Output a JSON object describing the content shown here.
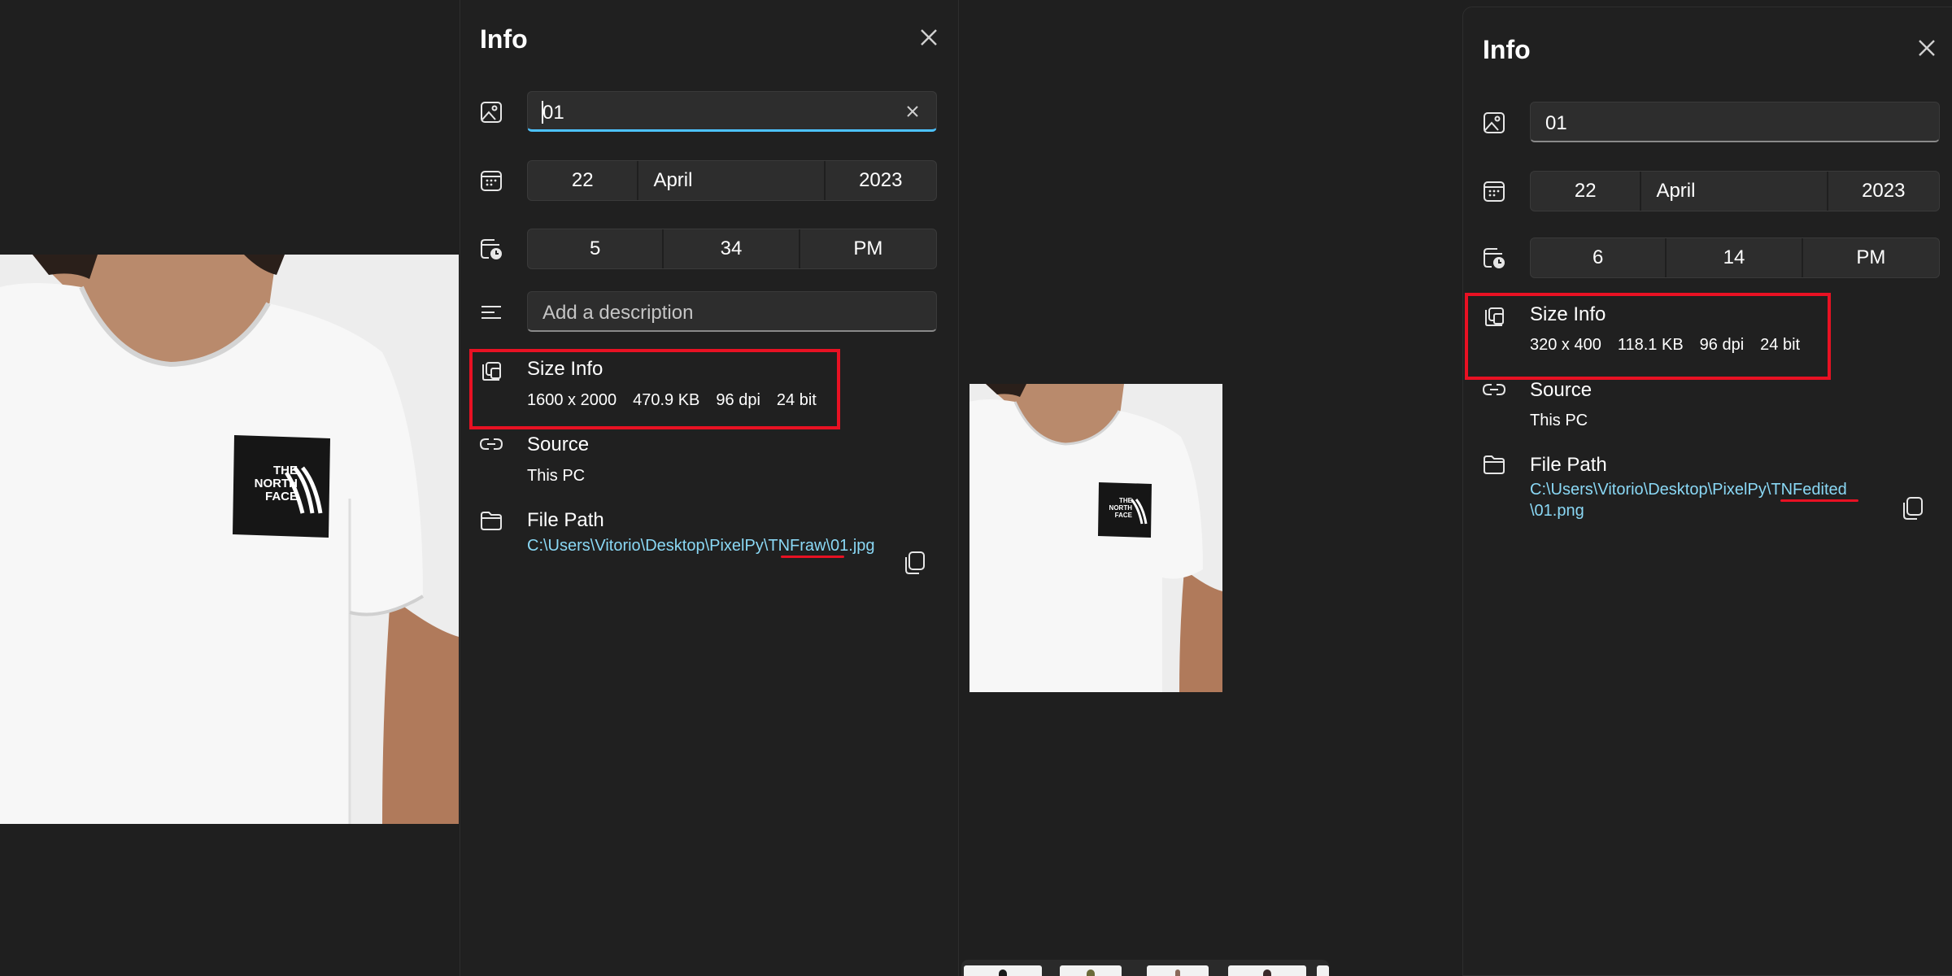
{
  "colors": {
    "background": "#1f1f1f",
    "panel": "#202020",
    "field": "#2d2d2d",
    "accent": "#4cc2ff",
    "link": "#8ad8f5",
    "highlight": "#e81123"
  },
  "photo_left": {
    "logo_lines": [
      "THE",
      "NORTH",
      "FACE"
    ]
  },
  "photo_mid": {
    "logo_lines": [
      "THE",
      "NORTH",
      "FACE"
    ]
  },
  "left_panel": {
    "title": "Info",
    "name_value": "01",
    "date": {
      "day": "22",
      "month": "April",
      "year": "2023"
    },
    "time": {
      "hour": "5",
      "minute": "34",
      "period": "PM"
    },
    "description_placeholder": "Add a description",
    "size_info": {
      "title": "Size Info",
      "dimensions": "1600 x 2000",
      "file_size": "470.9 KB",
      "dpi": "96 dpi",
      "bit_depth": "24 bit"
    },
    "source": {
      "title": "Source",
      "value": "This PC"
    },
    "file_path": {
      "title": "File Path",
      "value": "C:\\Users\\Vitorio\\Desktop\\PixelPy\\TNFraw\\01.jpg"
    }
  },
  "right_panel": {
    "title": "Info",
    "name_value": "01",
    "date": {
      "day": "22",
      "month": "April",
      "year": "2023"
    },
    "time": {
      "hour": "6",
      "minute": "14",
      "period": "PM"
    },
    "size_info": {
      "title": "Size Info",
      "dimensions": "320 x 400",
      "file_size": "118.1 KB",
      "dpi": "96 dpi",
      "bit_depth": "24 bit"
    },
    "source": {
      "title": "Source",
      "value": "This PC"
    },
    "file_path": {
      "title": "File Path",
      "line1": "C:\\Users\\Vitorio\\Desktop\\PixelPy\\TNFedited",
      "line2": "\\01.png"
    }
  },
  "icons": {
    "name": "image-icon",
    "date": "calendar-icon",
    "time": "clock-icon",
    "description": "text-lines-icon",
    "size": "size-info-icon",
    "source": "link-icon",
    "path": "folder-icon",
    "close": "close-icon",
    "copy": "copy-icon",
    "clear": "clear-icon"
  }
}
